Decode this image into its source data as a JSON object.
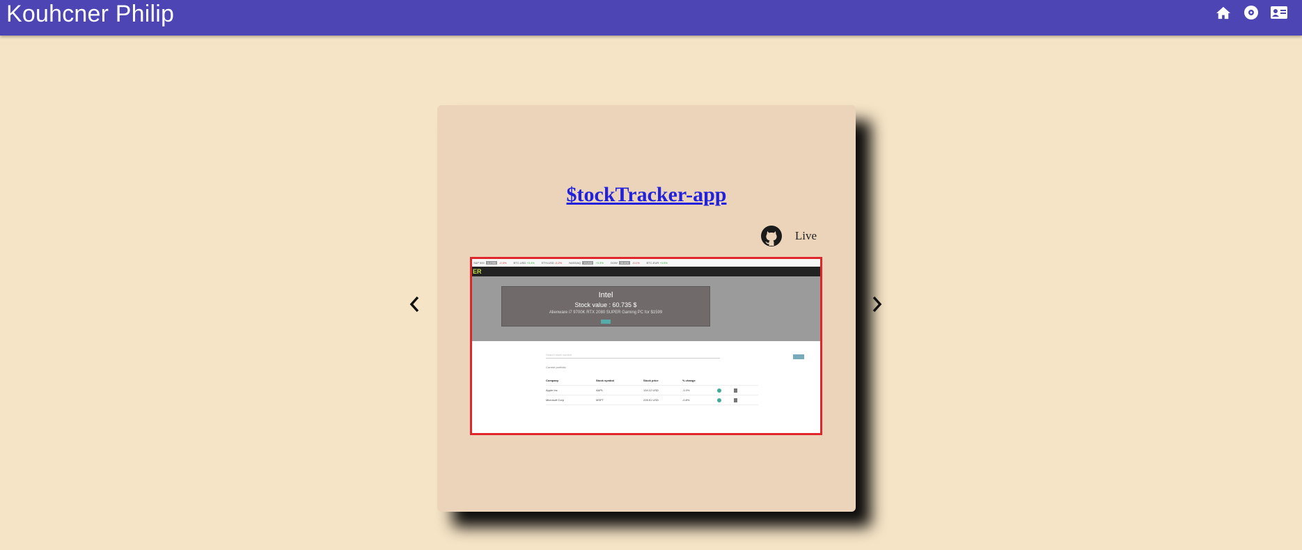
{
  "app": {
    "title": "Kouhcner Philip",
    "nav_icons": [
      "home-icon",
      "album-icon",
      "contact-card-icon"
    ],
    "colors": {
      "appbar": "#4c45b3",
      "background": "#f6e4c6",
      "card": "#ebd4b9",
      "link": "#2222dd",
      "preview_border": "#e0262b"
    }
  },
  "carousel": {
    "prev_icon": "chevron-left-icon",
    "next_icon": "chevron-right-icon",
    "card": {
      "title": "$tockTracker-app",
      "github_icon": "github-icon",
      "live_label": "Live",
      "preview": {
        "ticker": [
          {
            "sym": "S&P 500",
            "badge": "4,1789",
            "chg": "-0.3%",
            "dir": "neg"
          },
          {
            "sym": "BTC-USD",
            "badge": "",
            "chg": "+0.4%",
            "dir": "pos"
          },
          {
            "sym": "ETH-USD",
            "badge": "",
            "chg": "-0.2%",
            "dir": "neg"
          },
          {
            "sym": "NASDAQ",
            "badge": "13,210",
            "chg": "+0.3%",
            "dir": "pos"
          },
          {
            "sym": "DOW",
            "badge": "33,400",
            "chg": "-0.1%",
            "dir": "neg"
          },
          {
            "sym": "BTC-EUR",
            "badge": "",
            "chg": "+0.5%",
            "dir": "pos"
          }
        ],
        "nav_text": "ER",
        "stock_name": "Intel",
        "stock_value": "Stock value : 60.735 $",
        "news": "Alienware i7 9700K RTX 2080 SUPER Gaming PC for $1599",
        "search_placeholder": "Search stock symbol",
        "sub_text": "Current portfolio",
        "table": {
          "headers": [
            "Company",
            "Stock symbol",
            "Stock price",
            "% change"
          ],
          "rows": [
            [
              "Apple Inc",
              "AAPL",
              "134.12 USD",
              "-1.0%"
            ],
            [
              "Microsoft Corp",
              "MSFT",
              "228.51 USD",
              "-0.8%"
            ]
          ]
        }
      }
    }
  }
}
